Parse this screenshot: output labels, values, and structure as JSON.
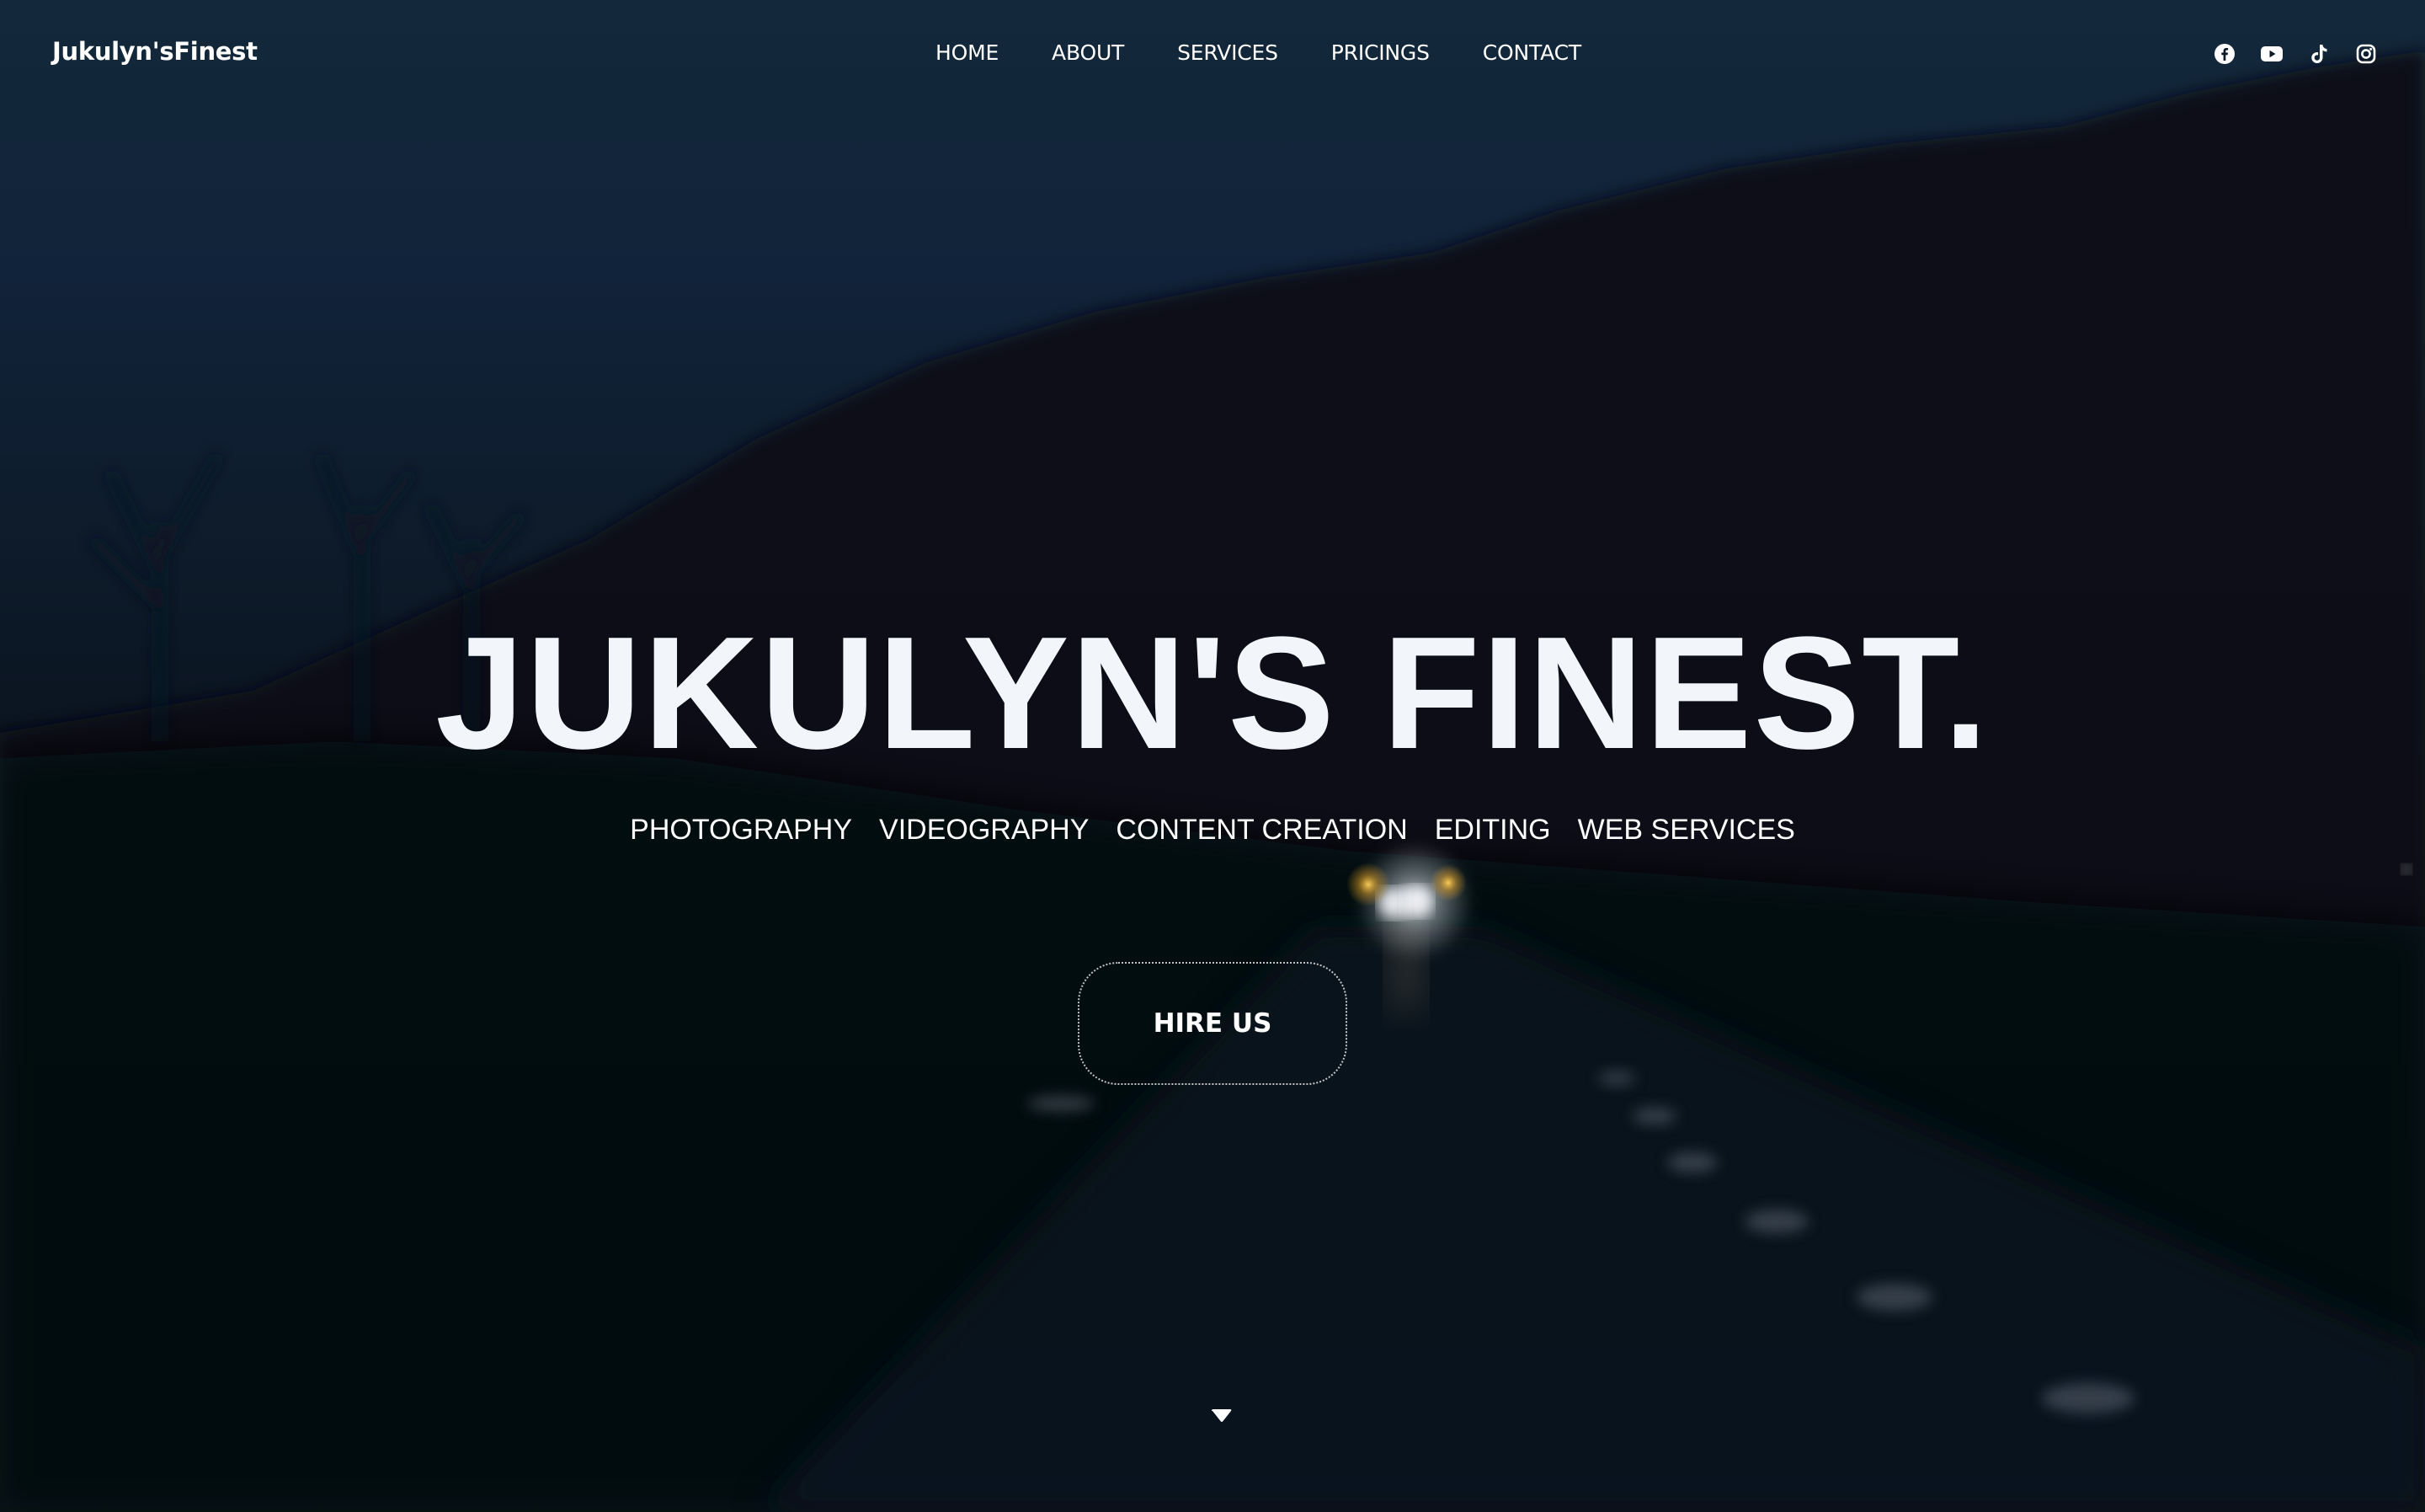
{
  "header": {
    "logo": "Jukulyn'sFinest",
    "nav": [
      {
        "label": "HOME"
      },
      {
        "label": "ABOUT"
      },
      {
        "label": "SERVICES"
      },
      {
        "label": "PRICINGS"
      },
      {
        "label": "CONTACT"
      }
    ],
    "social": [
      {
        "icon": "facebook-icon"
      },
      {
        "icon": "youtube-icon"
      },
      {
        "icon": "tiktok-icon"
      },
      {
        "icon": "instagram-icon"
      }
    ]
  },
  "hero": {
    "title": "JUKULYN'S FINEST.",
    "services": [
      "PHOTOGRAPHY",
      "VIDEOGRAPHY",
      "CONTENT CREATION",
      "EDITING",
      "WEB SERVICES"
    ],
    "cta_label": "HIRE US",
    "scroll_icon": "caret-down-icon"
  },
  "colors": {
    "text": "#ffffff",
    "title": "#f2f5f9",
    "background_top": "#13283a",
    "background_bottom": "#05080e"
  }
}
